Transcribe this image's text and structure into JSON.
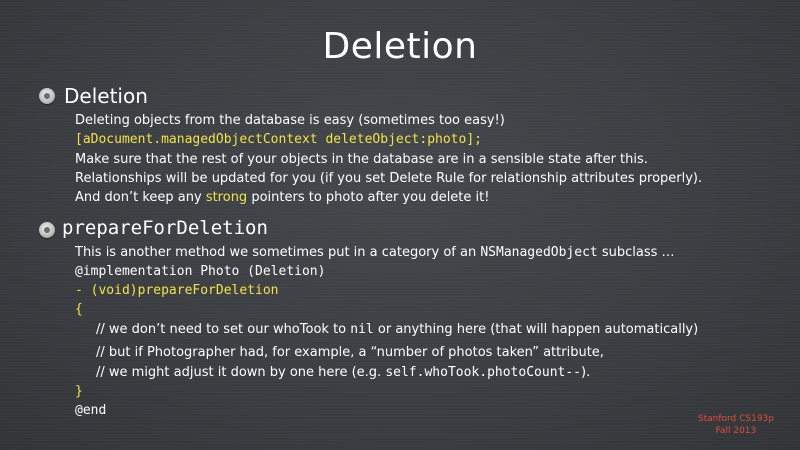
{
  "slide": {
    "title": "Deletion",
    "sections": [
      {
        "heading": "Deletion",
        "lines": {
          "l1": "Deleting objects from the database is easy (sometimes too easy!)",
          "l2": "[aDocument.managedObjectContext deleteObject:photo];",
          "l3": "Make sure that the rest of your objects in the database are in a sensible state after this.",
          "l4": "Relationships will be updated for you (if you set Delete Rule for relationship attributes properly).",
          "l5a": "And don’t keep any ",
          "l5b": "strong",
          "l5c": " pointers to ",
          "l5d": "photo",
          "l5e": " after you delete it!"
        }
      },
      {
        "heading": "prepareForDeletion",
        "lines": {
          "l1a": "This is another method we sometimes put in a category of an ",
          "l1b": "NSManagedObject",
          "l1c": " subclass …",
          "l2": "@implementation Photo (Deletion)",
          "l3": "- (void)prepareForDeletion",
          "l4": "{",
          "l5a": "// we don’t need to set our ",
          "l5b": "whoTook",
          "l5c": " to ",
          "l5d": "nil",
          "l5e": " or anything here (that will happen automatically)",
          "l6a": "// but if ",
          "l6b": "Photographer",
          "l6c": " had, for example, a “number of photos taken” attribute,",
          "l7a": "//      we might adjust it down by one here (e.g. ",
          "l7b": "self.whoTook.photoCount--",
          "l7c": ").",
          "l8": "}",
          "l9": "@end"
        }
      }
    ],
    "footer": {
      "line1": "Stanford CS193p",
      "line2": "Fall 2013"
    },
    "colors": {
      "background": "#3a3d40",
      "text": "#ffffff",
      "code_highlight": "#f2e24a",
      "footer": "#e04b3a"
    }
  }
}
